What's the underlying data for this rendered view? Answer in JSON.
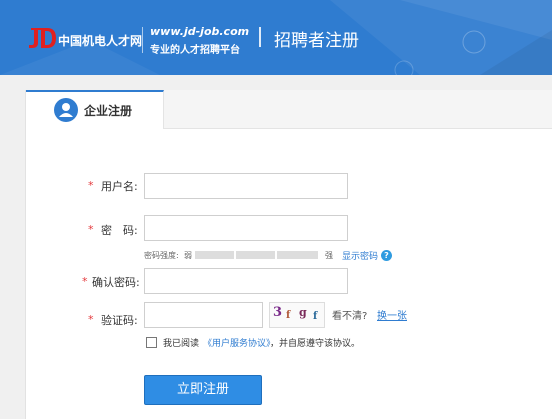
{
  "header": {
    "brand_name": "中国机电人才网",
    "url": "www.jd-job.com",
    "slogan": "专业的人才招聘平台",
    "page_title": "招聘者注册",
    "logo_icon": "jd-logo-icon",
    "colors": {
      "header_bg": "#2f7cd0",
      "logo_red": "#e02020"
    }
  },
  "tabs": [
    {
      "label": "企业注册",
      "icon": "user-icon",
      "active": true
    }
  ],
  "form": {
    "required_mark": "*",
    "username": {
      "label": "用户名:",
      "value": "",
      "placeholder": ""
    },
    "password": {
      "label": "密　码:",
      "value": "",
      "placeholder": "",
      "strength_label": "密码强度:",
      "strength_weak": "弱",
      "strength_strong": "强",
      "show_password_link": "显示密码",
      "help_icon": "?"
    },
    "confirm_password": {
      "label": "确认密码:",
      "value": "",
      "placeholder": ""
    },
    "captcha": {
      "label": "验证码:",
      "value": "",
      "placeholder": "",
      "image_chars": [
        "3",
        "f",
        "g",
        "f"
      ],
      "unclear_text": "看不清?",
      "refresh_link": "换一张"
    },
    "agreement": {
      "prefix": "我已阅读",
      "link": "《用户服务协议》",
      "suffix": "，并自愿遵守该协议。",
      "checked": false
    },
    "submit_label": "立即注册"
  },
  "colors": {
    "accent": "#2f7cd0",
    "required": "#e4393c",
    "button": "#2f8de4"
  }
}
